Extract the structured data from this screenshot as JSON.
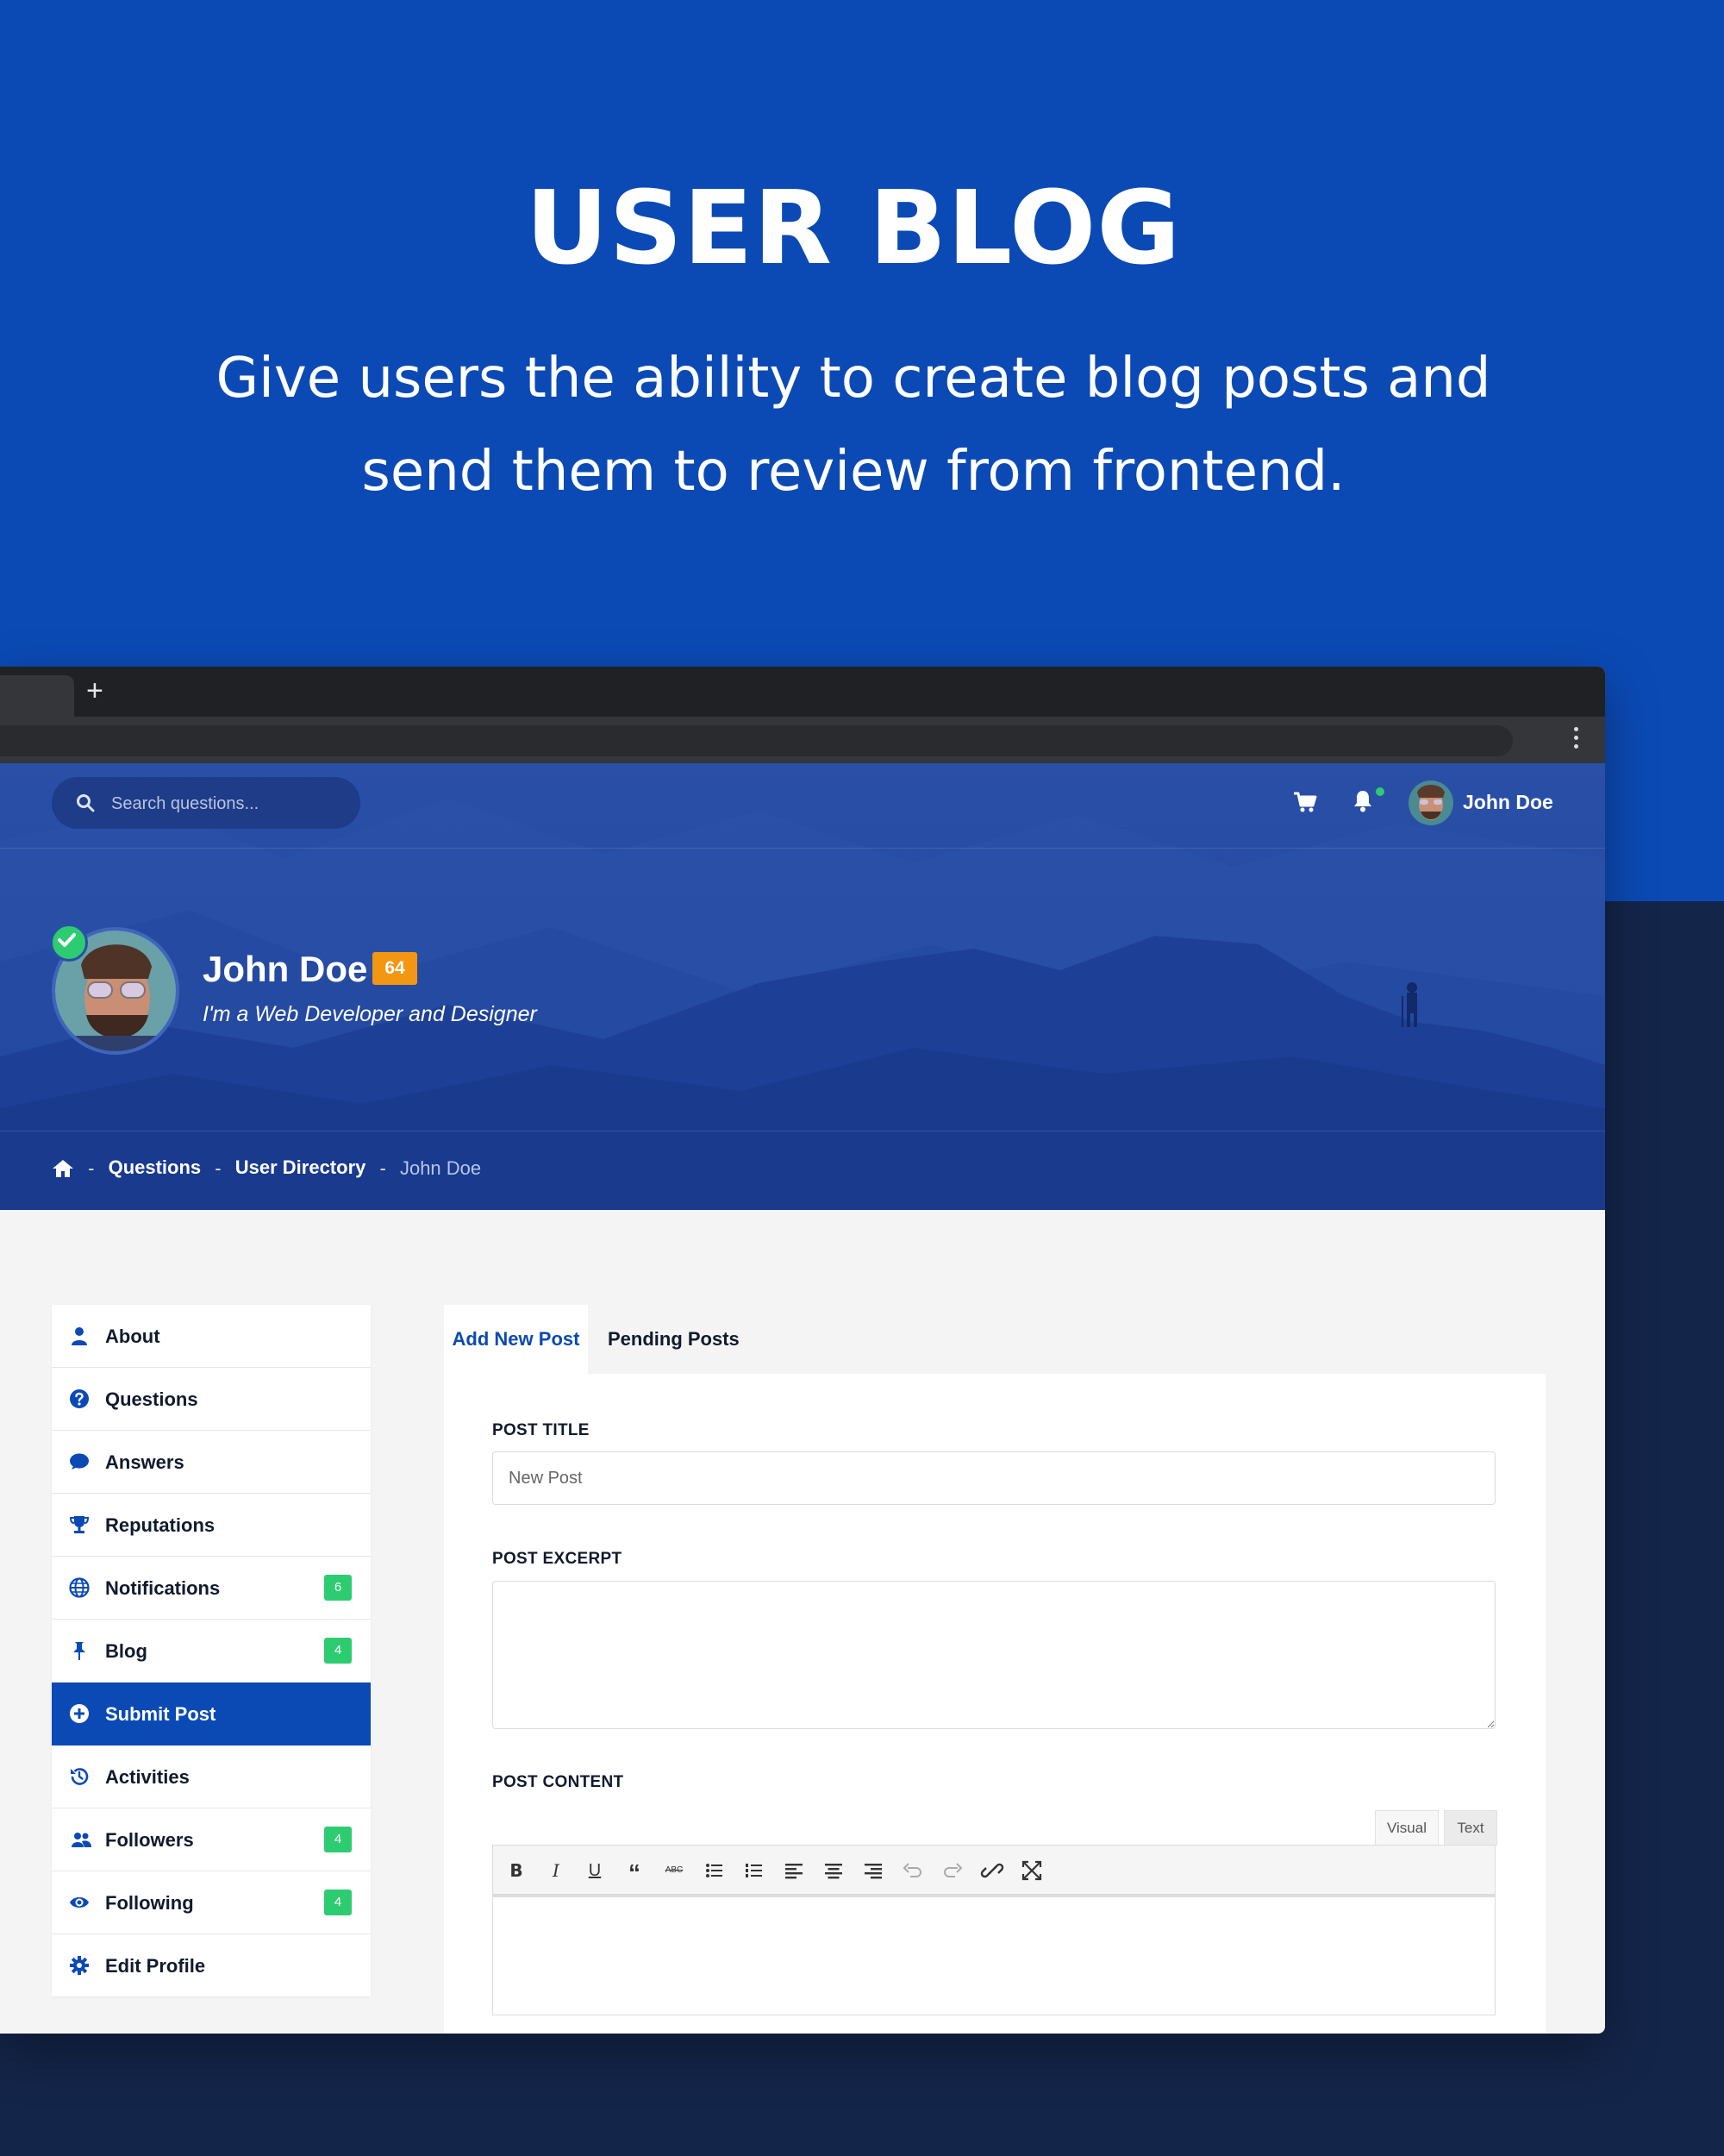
{
  "hero": {
    "title": "USER BLOG",
    "subtitle": "Give users the ability to create blog posts and send them to review from frontend."
  },
  "browser": {
    "new_tab_symbol": "+"
  },
  "topbar": {
    "search_placeholder": "Search questions...",
    "user_name": "John Doe",
    "icons": [
      "search-icon",
      "cart-icon",
      "bell-icon",
      "avatar"
    ]
  },
  "profile": {
    "name": "John Doe",
    "level": "64",
    "bio": "I'm a Web Developer and Designer"
  },
  "breadcrumb": {
    "items": [
      "Questions",
      "User Directory"
    ],
    "current": "John Doe",
    "separator": "-"
  },
  "sidebar": {
    "items": [
      {
        "label": "About",
        "icon": "user-icon",
        "badge": ""
      },
      {
        "label": "Questions",
        "icon": "question-circle-icon",
        "badge": ""
      },
      {
        "label": "Answers",
        "icon": "comment-icon",
        "badge": ""
      },
      {
        "label": "Reputations",
        "icon": "trophy-icon",
        "badge": ""
      },
      {
        "label": "Notifications",
        "icon": "globe-icon",
        "badge": "6"
      },
      {
        "label": "Blog",
        "icon": "pin-icon",
        "badge": "4"
      },
      {
        "label": "Submit Post",
        "icon": "plus-circle-icon",
        "badge": "",
        "active": true
      },
      {
        "label": "Activities",
        "icon": "history-icon",
        "badge": ""
      },
      {
        "label": "Followers",
        "icon": "users-icon",
        "badge": "4"
      },
      {
        "label": "Following",
        "icon": "eye-icon",
        "badge": "4"
      },
      {
        "label": "Edit Profile",
        "icon": "gear-icon",
        "badge": ""
      }
    ]
  },
  "post_tabs": {
    "add": "Add New Post",
    "pending": "Pending Posts"
  },
  "form": {
    "title_label": "POST TITLE",
    "title_placeholder": "New Post",
    "excerpt_label": "POST EXCERPT",
    "content_label": "POST CONTENT",
    "editor_tabs": {
      "visual": "Visual",
      "text": "Text"
    },
    "toolbar": [
      "bold",
      "italic",
      "underline",
      "blockquote",
      "strikethrough",
      "bullet-list",
      "numbered-list",
      "align-left",
      "align-center",
      "align-right",
      "undo",
      "redo",
      "link",
      "fullscreen"
    ]
  },
  "colors": {
    "brand": "#0b4ab5",
    "dark": "#14254a",
    "badge_green": "#2ecc71",
    "level_orange": "#f39612"
  }
}
